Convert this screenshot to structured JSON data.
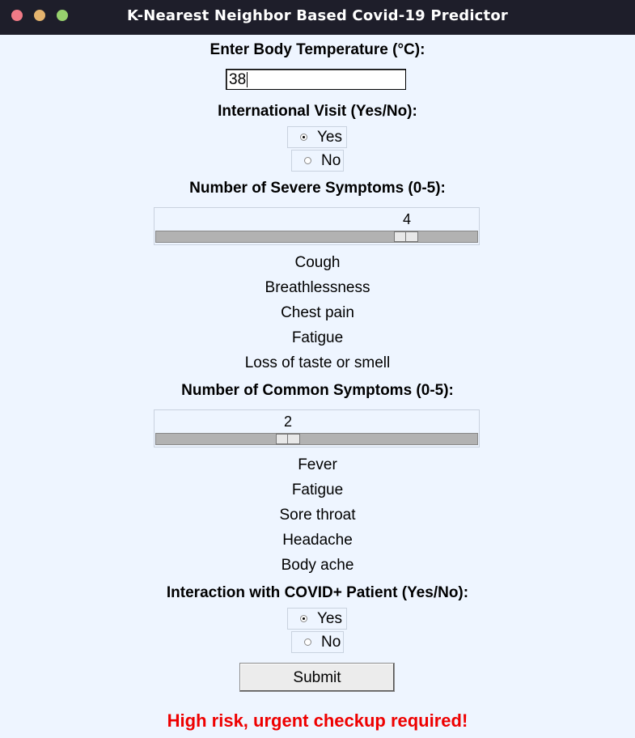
{
  "window": {
    "title": "K-Nearest Neighbor Based Covid-19 Predictor"
  },
  "temperature": {
    "label": "Enter Body Temperature (°C):",
    "value": "38"
  },
  "international_visit": {
    "label": "International Visit (Yes/No):",
    "options": [
      "Yes",
      "No"
    ],
    "selected": "Yes"
  },
  "severe_symptoms": {
    "label": "Number of Severe Symptoms (0-5):",
    "value": "4",
    "min": 0,
    "max": 5,
    "list": [
      "Cough",
      "Breathlessness",
      "Chest pain",
      "Fatigue",
      "Loss of taste or smell"
    ]
  },
  "common_symptoms": {
    "label": "Number of Common Symptoms (0-5):",
    "value": "2",
    "min": 0,
    "max": 5,
    "list": [
      "Fever",
      "Fatigue",
      "Sore throat",
      "Headache",
      "Body ache"
    ]
  },
  "covid_interaction": {
    "label": "Interaction with COVID+ Patient (Yes/No):",
    "options": [
      "Yes",
      "No"
    ],
    "selected": "Yes"
  },
  "submit_label": "Submit",
  "result": {
    "text": "High risk, urgent checkup required!",
    "color": "#ee0000"
  },
  "colors": {
    "background": "#eef5ff",
    "titlebar": "#1e1e2a"
  }
}
